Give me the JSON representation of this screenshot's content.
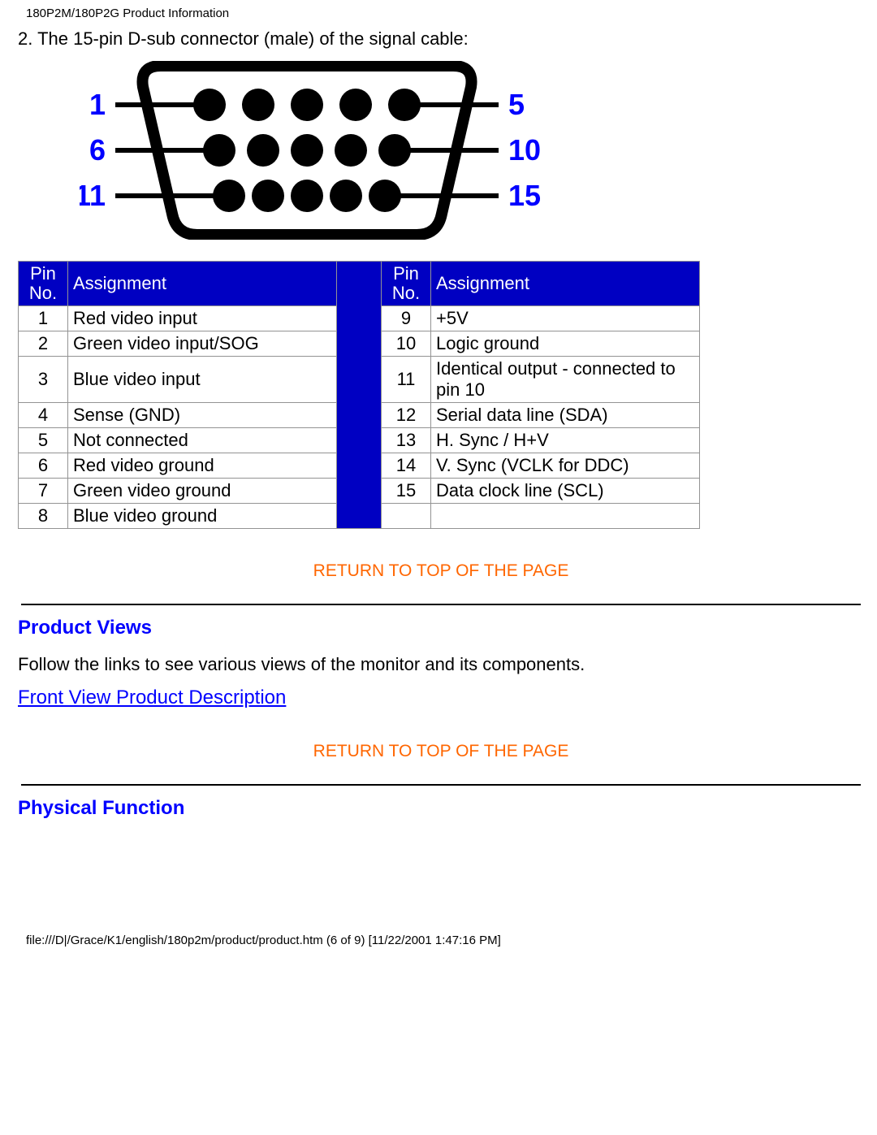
{
  "header": "180P2M/180P2G Product Information",
  "caption": "2. The 15-pin D-sub connector (male) of the signal cable:",
  "diagram_labels": {
    "tl": "1",
    "ml": "6",
    "bl": "11",
    "tr": "5",
    "mr": "10",
    "br": "15"
  },
  "table_headers": {
    "pin": "Pin No.",
    "assign": "Assignment"
  },
  "left_rows": [
    {
      "pin": "1",
      "assign": "Red video input"
    },
    {
      "pin": "2",
      "assign": "Green video input/SOG"
    },
    {
      "pin": "3",
      "assign": "Blue video input"
    },
    {
      "pin": "4",
      "assign": "Sense (GND)"
    },
    {
      "pin": "5",
      "assign": "Not connected"
    },
    {
      "pin": "6",
      "assign": "Red video ground"
    },
    {
      "pin": "7",
      "assign": "Green video ground"
    },
    {
      "pin": "8",
      "assign": "Blue video ground"
    }
  ],
  "right_rows": [
    {
      "pin": "9",
      "assign": "+5V"
    },
    {
      "pin": "10",
      "assign": "Logic ground"
    },
    {
      "pin": "11",
      "assign": "Identical output - connected to pin 10"
    },
    {
      "pin": "12",
      "assign": "Serial data line (SDA)"
    },
    {
      "pin": "13",
      "assign": "H. Sync / H+V"
    },
    {
      "pin": "14",
      "assign": "V. Sync (VCLK for DDC)"
    },
    {
      "pin": "15",
      "assign": "Data clock line (SCL)"
    },
    {
      "pin": "",
      "assign": ""
    }
  ],
  "return_link": "RETURN TO TOP OF THE PAGE",
  "product_views": {
    "title": "Product Views",
    "text": "Follow the links to see various views of the monitor and its components.",
    "link": "Front View Product Description"
  },
  "physical_function": {
    "title": "Physical Function"
  },
  "footer": "file:///D|/Grace/K1/english/180p2m/product/product.htm (6 of 9) [11/22/2001 1:47:16 PM]",
  "chart_data": {
    "type": "table",
    "title": "15-pin D-sub connector pin assignment",
    "columns": [
      "Pin No.",
      "Assignment"
    ],
    "rows": [
      [
        1,
        "Red video input"
      ],
      [
        2,
        "Green video input/SOG"
      ],
      [
        3,
        "Blue video input"
      ],
      [
        4,
        "Sense (GND)"
      ],
      [
        5,
        "Not connected"
      ],
      [
        6,
        "Red video ground"
      ],
      [
        7,
        "Green video ground"
      ],
      [
        8,
        "Blue video ground"
      ],
      [
        9,
        "+5V"
      ],
      [
        10,
        "Logic ground"
      ],
      [
        11,
        "Identical output - connected to pin 10"
      ],
      [
        12,
        "Serial data line (SDA)"
      ],
      [
        13,
        "H. Sync / H+V"
      ],
      [
        14,
        "V. Sync (VCLK for DDC)"
      ],
      [
        15,
        "Data clock line (SCL)"
      ]
    ]
  }
}
